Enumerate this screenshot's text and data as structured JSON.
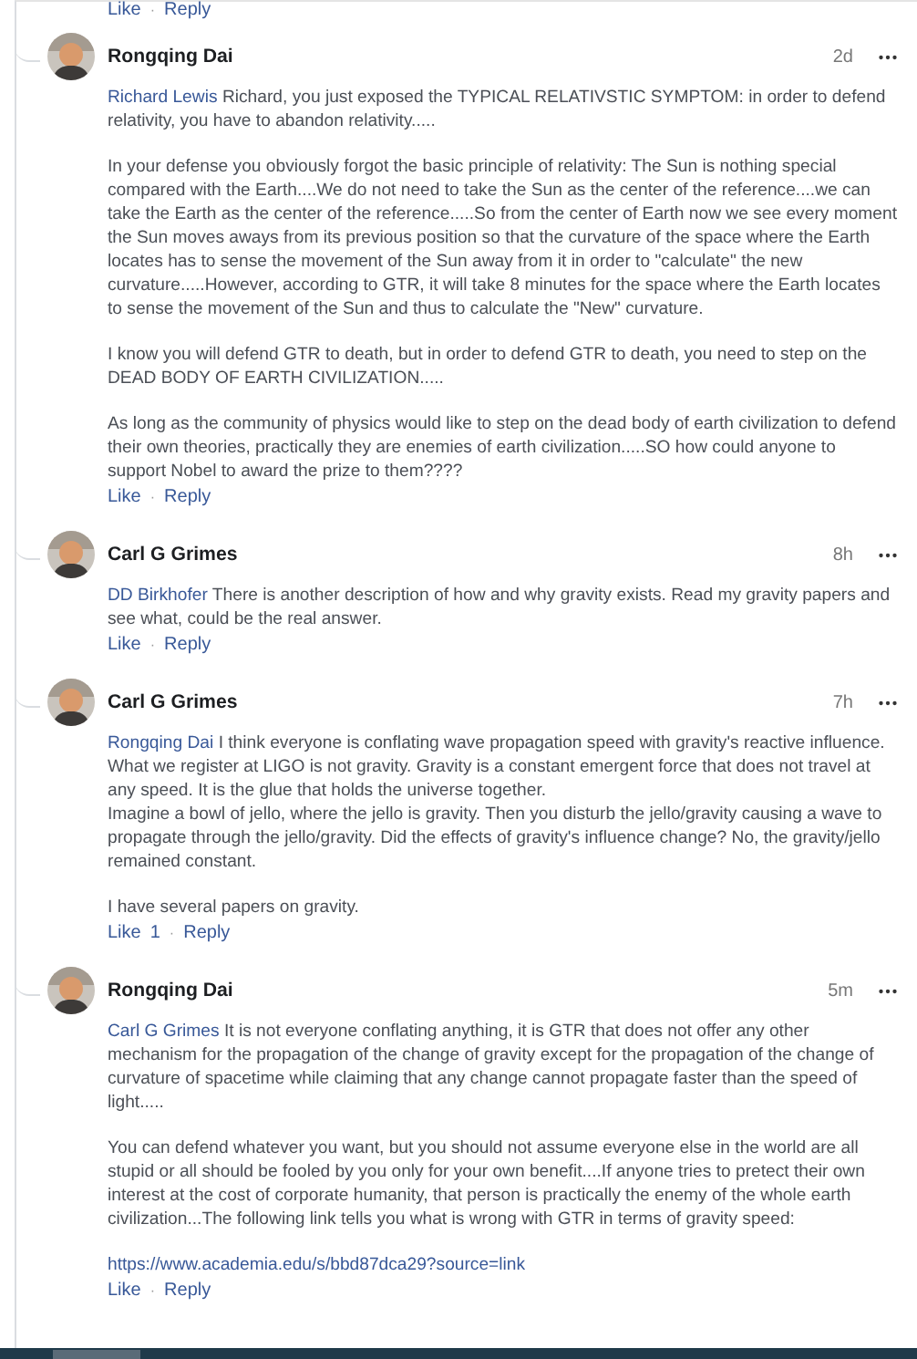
{
  "top_actions": {
    "like": "Like",
    "separator": "·",
    "reply": "Reply"
  },
  "comments": [
    {
      "author": "Rongqing Dai",
      "time": "2d",
      "avatar": {
        "kind": "picture"
      },
      "mention": "Richard Lewis",
      "paragraphs": [
        {
          "kind": "text",
          "text": "Richard, you just exposed the TYPICAL RELATIVSTIC SYMPTOM: in order to defend relativity, you have to abandon relativity....."
        },
        {
          "kind": "text",
          "text": "In your defense you obviously forgot the basic principle of relativity: The Sun is nothing special compared with the Earth....We do not need to take the Sun as the center of the reference....we can take the Earth as the center of the reference.....So from the center of Earth now we see every moment the Sun moves aways from its previous position so that the curvature of the space where the Earth locates has to sense the movement of the Sun away from it in order to \"calculate\" the new curvature.....However, according to GTR, it will take 8 minutes for the space where the Earth locates to sense the movement of the Sun and thus to calculate the \"New\" curvature."
        },
        {
          "kind": "text",
          "text": "I know you will defend GTR to death, but in order to defend GTR to death, you need to step on the DEAD BODY OF EARTH CIVILIZATION....."
        },
        {
          "kind": "text",
          "text": "As long as the community of physics would like to step on the dead body of earth civilization to defend their own theories, practically they are enemies of earth civilization.....SO how could anyone to support Nobel to award the prize to them????"
        }
      ],
      "actions": {
        "like": "Like",
        "separator": "·",
        "reply": "Reply"
      }
    },
    {
      "author": "Carl G Grimes",
      "time": "8h",
      "avatar": {
        "kind": "picture"
      },
      "mention": "DD Birkhofer",
      "paragraphs": [
        {
          "kind": "text",
          "text": "There is another description of how and why gravity exists. Read my gravity papers and see what, could be the real answer."
        }
      ],
      "actions": {
        "like": "Like",
        "separator": "·",
        "reply": "Reply"
      }
    },
    {
      "author": "Carl G Grimes",
      "time": "7h",
      "avatar": {
        "kind": "picture"
      },
      "mention": "Rongqing Dai",
      "paragraphs": [
        {
          "kind": "text",
          "text": "I think everyone is conflating wave propagation speed with gravity's reactive influence. What we register at LIGO is not gravity. Gravity is a constant emergent force that does not travel at any speed. It is the glue that holds the universe together.\nImagine a bowl of jello, where the jello is gravity. Then you disturb the jello/gravity causing a wave to propagate through the jello/gravity. Did the effects of gravity's influence change? No, the gravity/jello remained constant."
        },
        {
          "kind": "text",
          "text": "I have several papers on gravity."
        }
      ],
      "actions": {
        "like": "Like",
        "like_count": "1",
        "separator": "·",
        "reply": "Reply"
      }
    },
    {
      "author": "Rongqing Dai",
      "time": "5m",
      "avatar": {
        "kind": "picture"
      },
      "mention": "Carl G Grimes",
      "paragraphs": [
        {
          "kind": "text",
          "text": "It is not everyone conflating anything, it is GTR that does not offer any other mechanism for the propagation of the change of gravity except for the propagation of the change of curvature of spacetime while claiming that any change cannot propagate faster than the speed of light....."
        },
        {
          "kind": "text",
          "text": "You can defend whatever you want, but you should not assume everyone else in the world are all stupid or all should be fooled by you only for your own benefit....If anyone tries to pretect their own interest at the cost of corporate humanity, that person is practically the enemy of the whole earth civilization...The following link tells you what is wrong with GTR in terms of gravity speed:"
        },
        {
          "kind": "link",
          "text": "https://www.academia.edu/s/bbd87dca29?source=link"
        }
      ],
      "actions": {
        "like": "Like",
        "separator": "·",
        "reply": "Reply"
      }
    }
  ]
}
